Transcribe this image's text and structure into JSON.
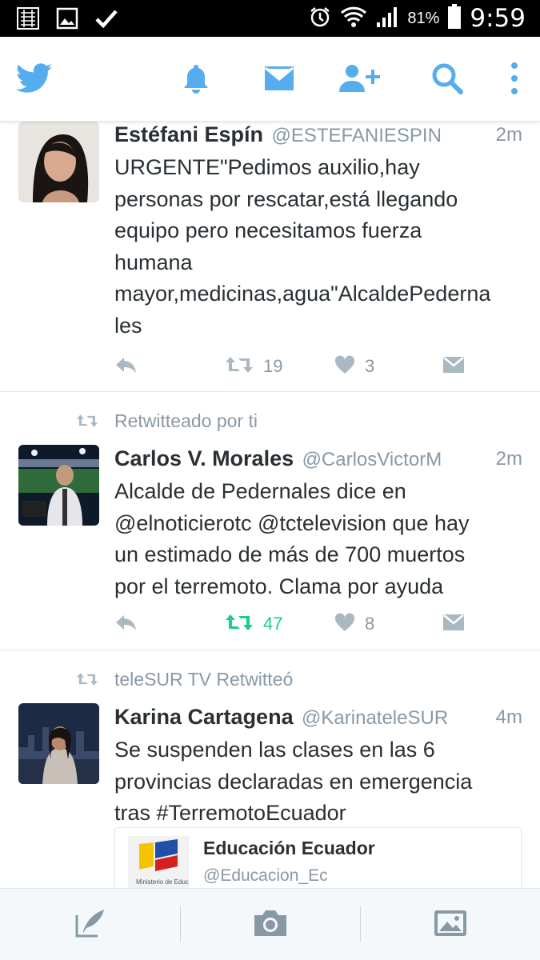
{
  "status_bar": {
    "battery_percent": "81%",
    "time": "9:59",
    "icons": [
      "app-grid-icon",
      "image-notification-icon",
      "check-icon",
      "alarm-icon",
      "wifi-icon",
      "signal-icon",
      "battery-icon"
    ]
  },
  "colors": {
    "accent": "#55acee",
    "retweet_active": "#19cf86",
    "muted": "#8899a6",
    "text": "#292f33"
  },
  "nav": {
    "icons": [
      "twitter-logo-icon",
      "notifications-bell-icon",
      "messages-envelope-icon",
      "add-user-icon",
      "search-icon",
      "overflow-menu-icon"
    ]
  },
  "tweets": [
    {
      "name": "Estéfani Espín",
      "handle": "@ESTEFANIESPIN",
      "time": "2m",
      "lines": [
        "URGENTE\"Pedimos auxilio,hay",
        "personas por rescatar,está llegando",
        "equipo pero necesitamos fuerza",
        "humana",
        "mayor,medicinas,agua\"AlcaldePederna",
        "les"
      ],
      "retweets": "19",
      "likes": "3",
      "retweeted_by_me": false
    },
    {
      "context": "Retwitteado por ti",
      "name": "Carlos V. Morales",
      "handle": "@CarlosVictorM",
      "time": "2m",
      "lines": [
        "Alcalde de Pedernales dice en",
        "@elnoticierotc @tctelevision que hay",
        "un estimado de más de 700 muertos",
        "por el terremoto. Clama por ayuda"
      ],
      "retweets": "47",
      "likes": "8",
      "retweeted_by_me": true
    },
    {
      "context": "teleSUR TV Retwitteó",
      "name": "Karina Cartagena",
      "handle": "@KarinateleSUR",
      "time": "4m",
      "lines": [
        "Se suspenden las clases en las 6",
        "provincias declaradas en emergencia",
        "tras #TerremotoEcuador"
      ],
      "card": {
        "title": "Educación Ecuador",
        "handle": "@Educacion_Ec",
        "logo_text": "Ministerio de Educación"
      }
    }
  ],
  "bottom_bar": {
    "icons": [
      "compose-tweet-icon",
      "camera-icon",
      "gallery-icon"
    ]
  }
}
